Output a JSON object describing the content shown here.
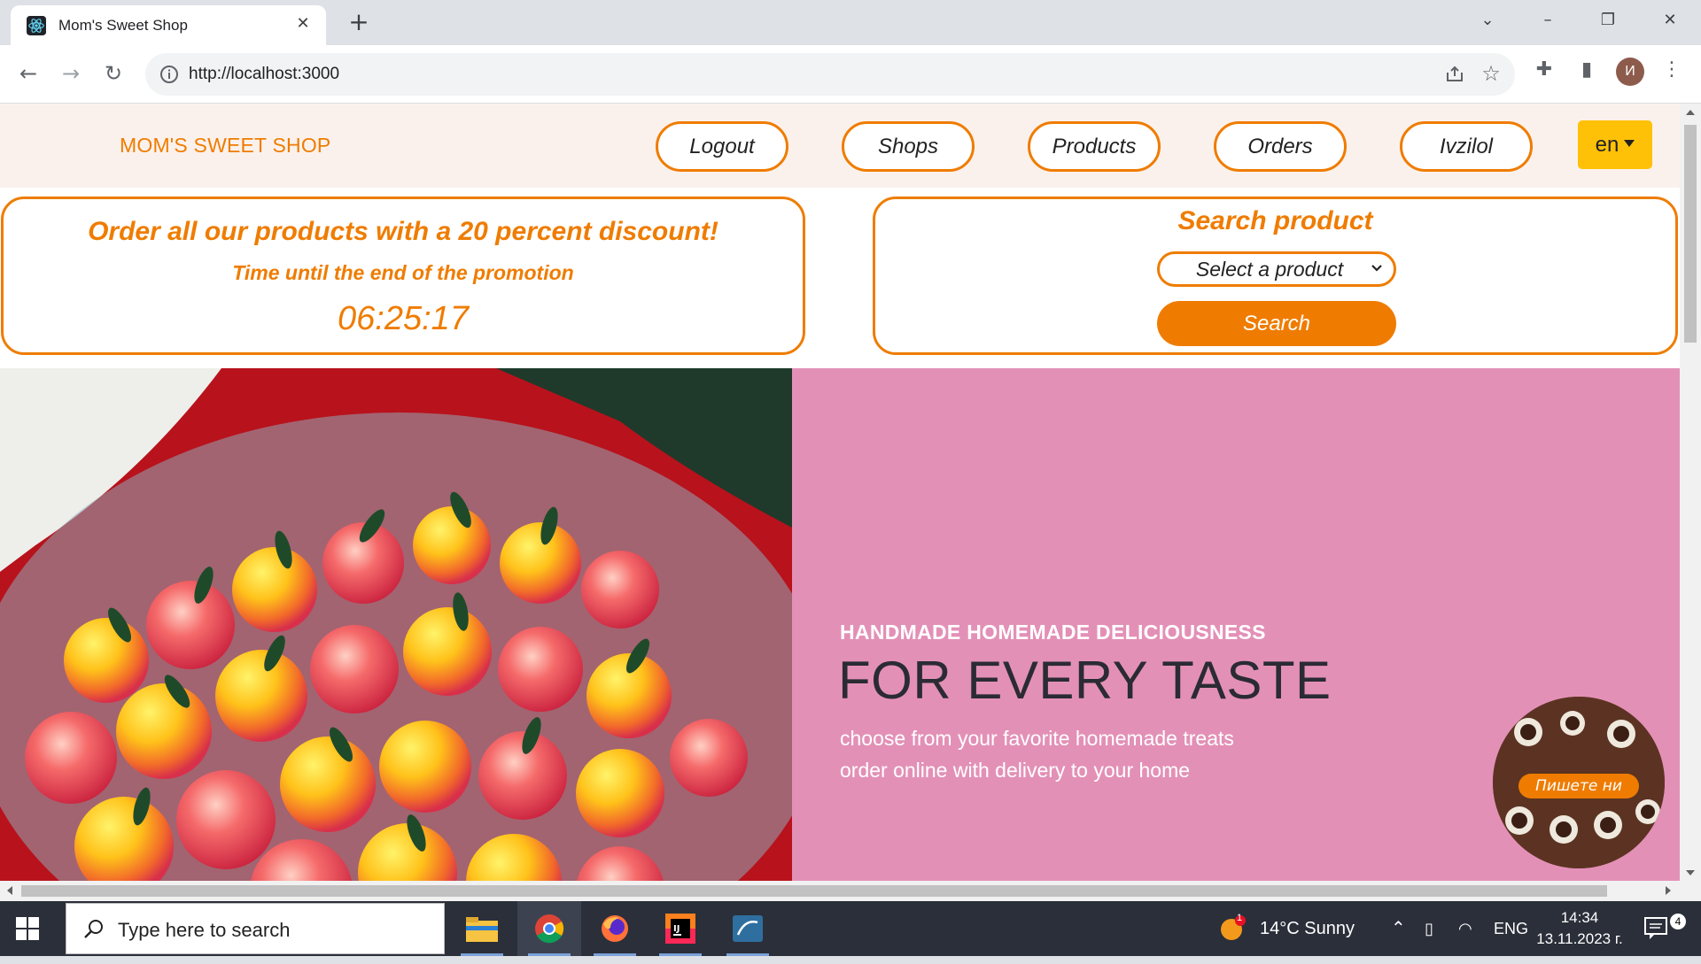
{
  "browser": {
    "tab_title": "Mom's Sweet Shop",
    "url": "http://localhost:3000",
    "profile_initial": "И"
  },
  "site": {
    "brand": "MOM'S SWEET SHOP",
    "nav": [
      {
        "label": "Logout"
      },
      {
        "label": "Shops"
      },
      {
        "label": "Products"
      },
      {
        "label": "Orders"
      },
      {
        "label": "Ivzilol"
      }
    ],
    "language": "en",
    "promo": {
      "headline": "Order all our products with a 20 percent discount!",
      "subtitle": "Time until the end of the promotion",
      "countdown": "06:25:17"
    },
    "search": {
      "heading": "Search product",
      "select_value": "Select a product",
      "button": "Search"
    },
    "hero": {
      "kicker": "HANDMADE HOMEMADE DELICIOUSNESS",
      "title": "FOR EVERY TASTE",
      "line1": "choose from your favorite homemade treats",
      "line2": "order online with delivery to your home"
    },
    "chat_label": "Пишете ни"
  },
  "taskbar": {
    "search_placeholder": "Type here to search",
    "weather": "14°C  Sunny",
    "weather_badge": "1",
    "language": "ENG",
    "time": "14:34",
    "date": "13.11.2023 г.",
    "notifications": "4"
  },
  "colors": {
    "accent": "#ef7c00",
    "nav_bg": "#fbf1ec",
    "hero_pink": "#e390b7",
    "lang_button": "#ffc107"
  }
}
